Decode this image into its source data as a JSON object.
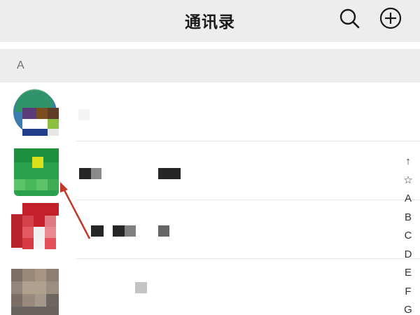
{
  "header": {
    "title": "通讯录",
    "search_icon": "search-icon",
    "add_icon": "add-circle-icon"
  },
  "section": {
    "letter": "A"
  },
  "contacts": [
    {
      "name": "",
      "avatar": "pixelated-logo"
    },
    {
      "name": "",
      "avatar": "green-pixelated"
    },
    {
      "name": "",
      "avatar": "red-pixelated"
    },
    {
      "name": "",
      "avatar": "brown-pixelated"
    }
  ],
  "index_bar": {
    "items": [
      "↑",
      "☆",
      "A",
      "B",
      "C",
      "D",
      "E",
      "F",
      "G"
    ]
  },
  "annotation": {
    "type": "arrow",
    "color": "#c0392b"
  }
}
